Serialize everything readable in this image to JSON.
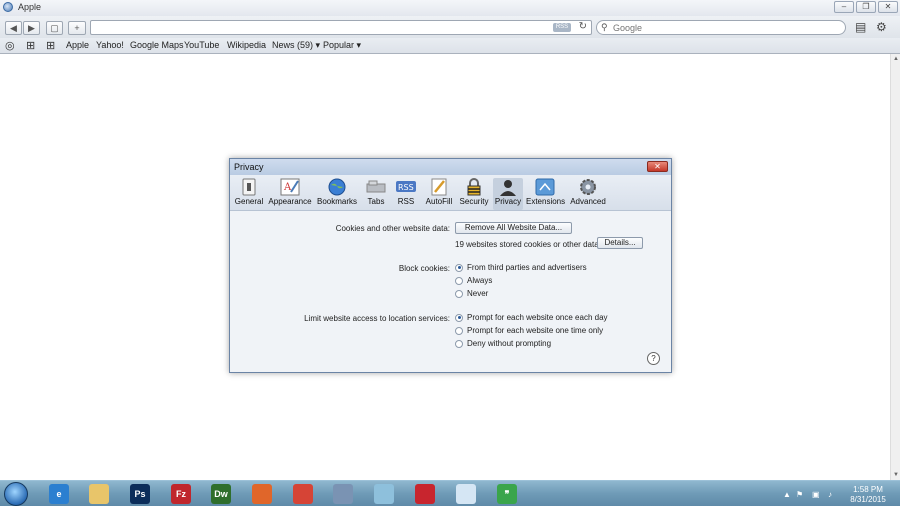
{
  "window": {
    "title": "Apple",
    "buttons": [
      "minimize",
      "restore",
      "close"
    ]
  },
  "toolbar": {
    "back_icon": "back-arrow-icon",
    "forward_icon": "forward-arrow-icon",
    "address_value": "",
    "rss_badge": "RSS",
    "search_placeholder": "Google"
  },
  "bookmarks": {
    "items": [
      {
        "label": "Apple"
      },
      {
        "label": "Yahoo!"
      },
      {
        "label": "Google Maps"
      },
      {
        "label": "YouTube"
      },
      {
        "label": "Wikipedia"
      },
      {
        "label": "News (59) ▾"
      },
      {
        "label": "Popular ▾"
      }
    ]
  },
  "dialog": {
    "title": "Privacy",
    "tabs": [
      {
        "label": "General",
        "icon": "general-switch-icon"
      },
      {
        "label": "Appearance",
        "icon": "appearance-icon"
      },
      {
        "label": "Bookmarks",
        "icon": "globe-icon"
      },
      {
        "label": "Tabs",
        "icon": "tabs-icon"
      },
      {
        "label": "RSS",
        "icon": "rss-icon"
      },
      {
        "label": "AutoFill",
        "icon": "pencil-icon"
      },
      {
        "label": "Security",
        "icon": "lock-icon"
      },
      {
        "label": "Privacy",
        "icon": "person-silhouette-icon"
      },
      {
        "label": "Extensions",
        "icon": "puzzle-icon"
      },
      {
        "label": "Advanced",
        "icon": "gear-icon"
      }
    ],
    "active_tab": "Privacy",
    "cookies_label": "Cookies and other website data:",
    "remove_all_button": "Remove All Website Data...",
    "stored_info": "19 websites stored cookies or other data",
    "details_button": "Details...",
    "block_label": "Block cookies:",
    "block_options": [
      "From third parties and advertisers",
      "Always",
      "Never"
    ],
    "block_selected": 0,
    "location_label": "Limit website access to location services:",
    "location_options": [
      "Prompt for each website once each day",
      "Prompt for each website one time only",
      "Deny without prompting"
    ],
    "location_selected": 0,
    "help_label": "?"
  },
  "taskbar": {
    "apps": [
      {
        "name": "internet-explorer",
        "label": "e",
        "color": "#2b7fd0"
      },
      {
        "name": "file-explorer",
        "label": "",
        "color": "#e8c56a"
      },
      {
        "name": "photoshop",
        "label": "Ps",
        "color": "#0c2d5a"
      },
      {
        "name": "filezilla",
        "label": "Fz",
        "color": "#c0262c"
      },
      {
        "name": "dreamweaver",
        "label": "Dw",
        "color": "#2f6e2c"
      },
      {
        "name": "firefox",
        "label": "",
        "color": "#e0662a"
      },
      {
        "name": "chrome",
        "label": "",
        "color": "#d64436"
      },
      {
        "name": "safari",
        "label": "",
        "color": "#7a93b3"
      },
      {
        "name": "notepad",
        "label": "",
        "color": "#8ec0dc"
      },
      {
        "name": "media",
        "label": "",
        "color": "#c8252e"
      },
      {
        "name": "document",
        "label": "",
        "color": "#d5e6f4"
      },
      {
        "name": "hangouts",
        "label": "❞",
        "color": "#3aa54b"
      }
    ],
    "time": "1:58 PM",
    "date": "8/31/2015"
  }
}
